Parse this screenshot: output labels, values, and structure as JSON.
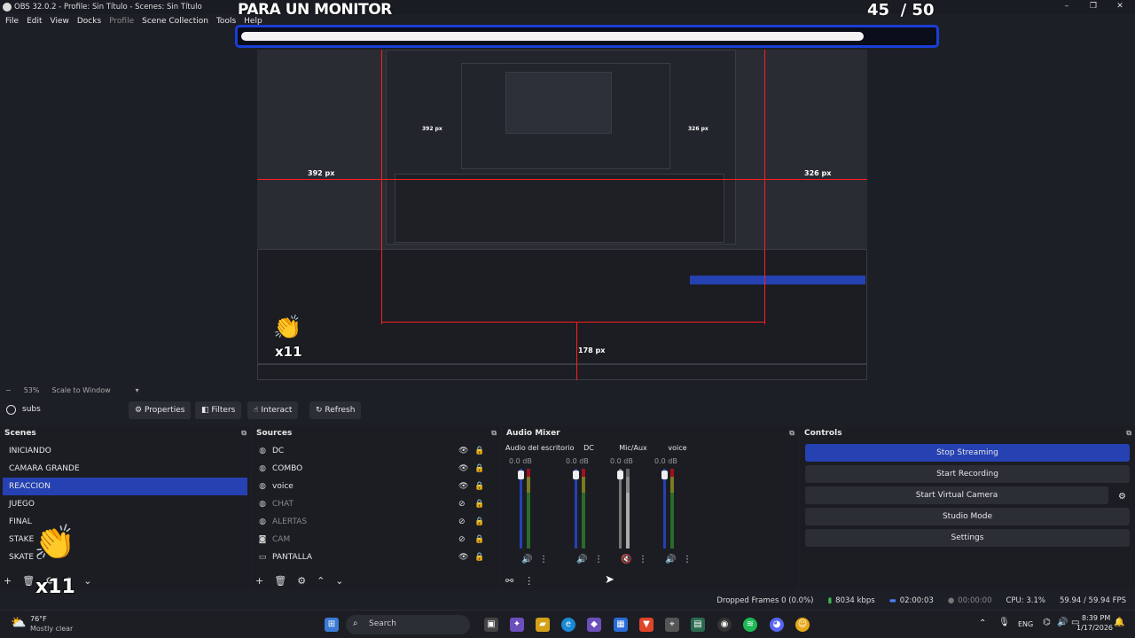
{
  "window": {
    "title": "OBS 32.0.2 - Profile: Sin Título - Scenes: Sin Título",
    "controls": [
      "–",
      "❐",
      "✕"
    ]
  },
  "menu": [
    "File",
    "Edit",
    "View",
    "Docks",
    "Profile",
    "Scene Collection",
    "Tools",
    "Help"
  ],
  "overlay": {
    "title": "PARA UN MONITOR",
    "counter": "45  / 50",
    "progress": 0.9
  },
  "preview": {
    "labels": {
      "left": "392 px",
      "right": "326 px",
      "bottom": "178 px",
      "inner_left": "392 px",
      "inner_right": "326 px"
    }
  },
  "preview_bar": {
    "zoom": "53%",
    "scale": "Scale to Window"
  },
  "source_bar": {
    "current": "subs",
    "buttons": [
      "Properties",
      "Filters",
      "Interact",
      "Refresh"
    ]
  },
  "scenes": {
    "title": "Scenes",
    "items": [
      "INICIANDO",
      "CAMARA GRANDE",
      "REACCION",
      "JUEGO",
      "FINAL",
      "STAKE",
      "SKATE C"
    ],
    "selected_index": 2
  },
  "sources": {
    "title": "Sources",
    "items": [
      {
        "name": "DC",
        "icon": "globe-icon",
        "visible": true
      },
      {
        "name": "COMBO",
        "icon": "globe-icon",
        "visible": true
      },
      {
        "name": "voice",
        "icon": "globe-icon",
        "visible": true
      },
      {
        "name": "CHAT",
        "icon": "globe-icon",
        "visible": false
      },
      {
        "name": "ALERTAS",
        "icon": "globe-icon",
        "visible": false
      },
      {
        "name": "CAM",
        "icon": "camera-icon",
        "visible": false
      },
      {
        "name": "PANTALLA",
        "icon": "monitor-icon",
        "visible": true
      }
    ]
  },
  "mixer": {
    "title": "Audio Mixer",
    "channels": [
      {
        "name": "Audio del escritorio",
        "db": "0.0 dB"
      },
      {
        "name": "DC",
        "db": "0.0 dB"
      },
      {
        "name": "Mic/Aux",
        "db": "0.0 dB"
      },
      {
        "name": "voice",
        "db": "0.0 dB"
      }
    ]
  },
  "controls": {
    "title": "Controls",
    "buttons": [
      "Stop Streaming",
      "Start Recording",
      "Start Virtual Camera",
      "Studio Mode",
      "Settings"
    ]
  },
  "status": {
    "dropped": "Dropped Frames 0 (0.0%)",
    "bitrate": "8034 kbps",
    "stream_time": "02:00:03",
    "rec_time": "00:00:00",
    "cpu": "CPU: 3.1%",
    "fps": "59.94 / 59.94 FPS"
  },
  "taskbar": {
    "weather_temp": "76°F",
    "weather_desc": "Mostly clear",
    "search": "Search",
    "lang": "ENG",
    "time": "8:39 PM",
    "date": "1/17/2026"
  },
  "stickers": {
    "multiplier": "x11"
  },
  "colors": {
    "accent": "#2541b2",
    "guide": "#ff1e1e",
    "progress_border": "#1a3ed6"
  }
}
